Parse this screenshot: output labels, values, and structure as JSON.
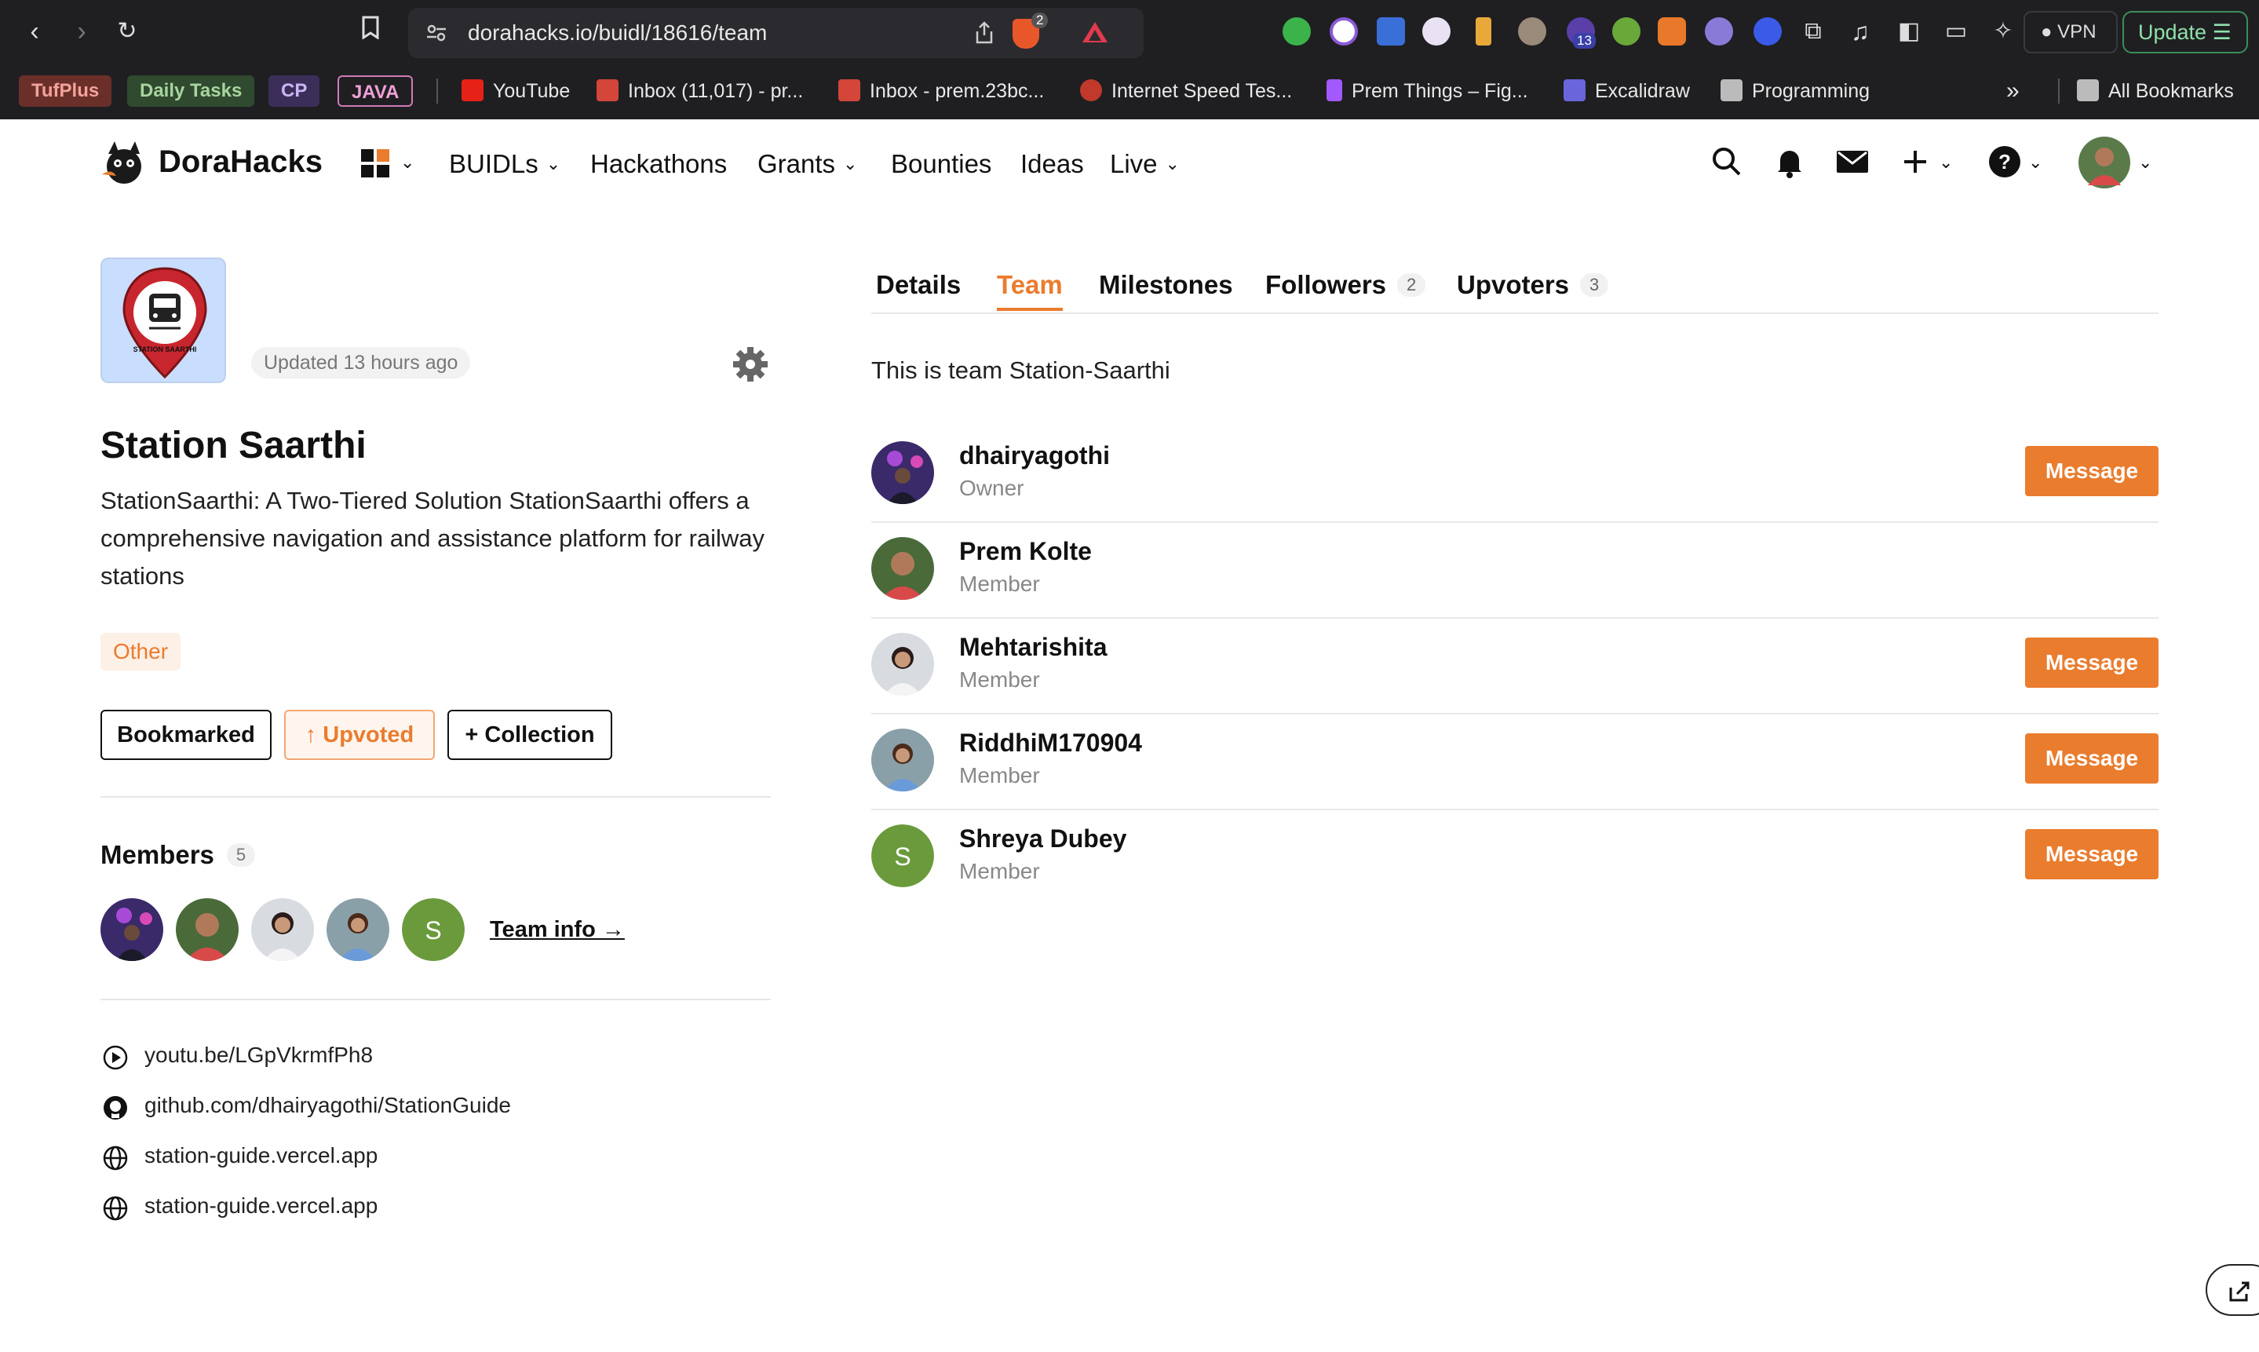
{
  "browser": {
    "url": "dorahacks.io/buidl/18616/team",
    "shield_count": "2",
    "ext_badge": "13",
    "vpn_label": "VPN",
    "update_label": "Update",
    "bookmarks": [
      {
        "label": "TufPlus",
        "kind": "chip",
        "color": "#6b2f2a",
        "text_color": "#f3a39a"
      },
      {
        "label": "Daily Tasks",
        "kind": "chip",
        "color": "#2f4a2e",
        "text_color": "#a8d49f"
      },
      {
        "label": "CP",
        "kind": "chip",
        "color": "#3b2f5a",
        "text_color": "#c8b6f4"
      },
      {
        "label": "JAVA",
        "kind": "chip-outline",
        "color": "#2a1f2a",
        "text_color": "#f0a0d8"
      },
      {
        "label": "YouTube"
      },
      {
        "label": "Inbox (11,017) - pr..."
      },
      {
        "label": "Inbox - prem.23bc..."
      },
      {
        "label": "Internet Speed Tes..."
      },
      {
        "label": "Prem Things – Fig..."
      },
      {
        "label": "Excalidraw"
      },
      {
        "label": "Programming"
      }
    ],
    "all_bookmarks": "All Bookmarks",
    "overflow": "»"
  },
  "site": {
    "brand": "DoraHacks",
    "nav": [
      "BUIDLs",
      "Hackathons",
      "Grants",
      "Bounties",
      "Ideas",
      "Live"
    ]
  },
  "project": {
    "updated": "Updated 13 hours ago",
    "title": "Station Saarthi",
    "description": "StationSaarthi: A Two-Tiered Solution StationSaarthi offers a comprehensive navigation and assistance platform for railway stations",
    "tag": "Other",
    "logo_text": "STATION SAARTHI",
    "buttons": {
      "bookmarked": "Bookmarked",
      "upvoted": "↑ Upvoted",
      "collection": "+ Collection"
    },
    "members_label": "Members",
    "members_count": "5",
    "team_info": "Team info →",
    "links": [
      "youtu.be/LGpVkrmfPh8",
      "github.com/dhairyagothi/StationGuide",
      "station-guide.vercel.app",
      "station-guide.vercel.app"
    ]
  },
  "tabs": [
    {
      "label": "Details"
    },
    {
      "label": "Team",
      "active": true
    },
    {
      "label": "Milestones"
    },
    {
      "label": "Followers",
      "count": "2"
    },
    {
      "label": "Upvoters",
      "count": "3"
    }
  ],
  "team": {
    "description": "This is team Station-Saarthi",
    "message_label": "Message",
    "members": [
      {
        "name": "dhairyagothi",
        "role": "Owner",
        "message": true
      },
      {
        "name": "Prem Kolte",
        "role": "Member",
        "message": false
      },
      {
        "name": "Mehtarishita",
        "role": "Member",
        "message": true
      },
      {
        "name": "RiddhiM170904",
        "role": "Member",
        "message": true
      },
      {
        "name": "Shreya Dubey",
        "role": "Member",
        "message": true,
        "initial": "S"
      }
    ]
  },
  "colors": {
    "accent": "#ea7c2e",
    "initial_avatar": "#6a9a3c"
  }
}
